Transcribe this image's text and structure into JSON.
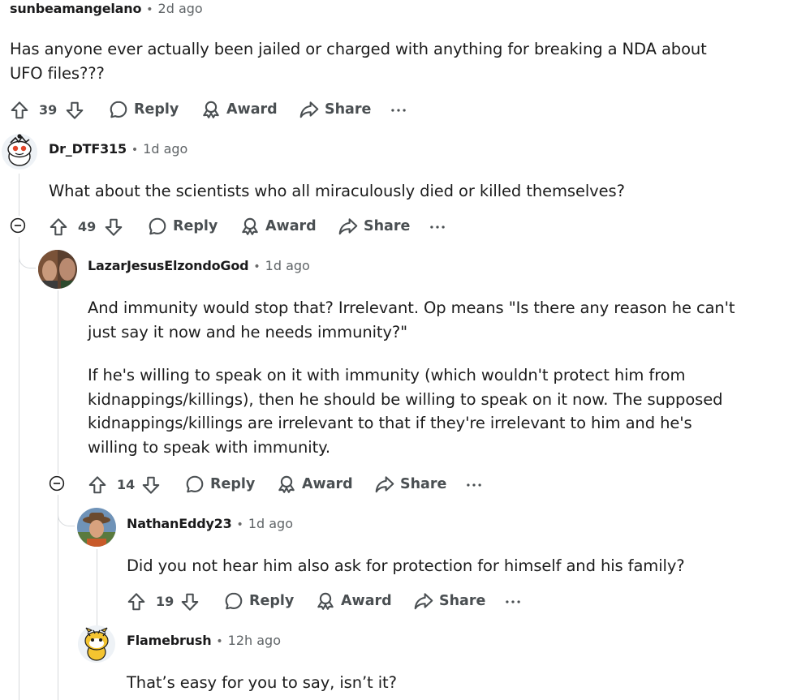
{
  "comments": [
    {
      "username": "sunbeamangelano",
      "separator": "•",
      "time": "2d ago",
      "text_lines": [
        "Has anyone ever actually been jailed or charged with anything for breaking a NDA about",
        "UFO files???"
      ],
      "votes": "39",
      "reply_label": "Reply",
      "award_label": "Award",
      "share_label": "Share",
      "more_label": "···"
    },
    {
      "username": "Dr_DTF315",
      "separator": "•",
      "time": "1d ago",
      "text_lines": [
        "What about the scientists who all miraculously died or killed themselves?"
      ],
      "votes": "49",
      "reply_label": "Reply",
      "award_label": "Award",
      "share_label": "Share",
      "more_label": "···"
    },
    {
      "username": "LazarJesusElzondoGod",
      "separator": "•",
      "time": "1d ago",
      "paragraph1_lines": [
        "And immunity would stop that? Irrelevant. Op means \"Is there any reason he can't",
        "just say it now and he needs immunity?\""
      ],
      "paragraph2_lines": [
        "If he's willing to speak on it with immunity (which wouldn't protect him from",
        "kidnappings/killings), then he should be willing to speak on it now. The supposed",
        "kidnappings/killings are irrelevant to that if they're irrelevant to him and he's",
        "willing to speak with immunity."
      ],
      "votes": "14",
      "reply_label": "Reply",
      "award_label": "Award",
      "share_label": "Share",
      "more_label": "···"
    },
    {
      "username": "NathanEddy23",
      "separator": "•",
      "time": "1d ago",
      "text_lines": [
        "Did you not hear him also ask for protection for himself and his family?"
      ],
      "votes": "19",
      "reply_label": "Reply",
      "award_label": "Award",
      "share_label": "Share",
      "more_label": "···"
    },
    {
      "username": "Flamebrush",
      "separator": "•",
      "time": "12h ago",
      "text_lines": [
        "That’s easy for you to say, isn’t it?"
      ]
    }
  ],
  "icons": {
    "upvote": "upvote-arrow-icon",
    "downvote": "downvote-arrow-icon",
    "reply": "speech-bubble-icon",
    "award": "award-ribbon-icon",
    "share": "share-arrow-icon",
    "more": "more-options-icon",
    "collapse": "collapse-minus-icon"
  },
  "colors": {
    "text": "#1c1c1c",
    "meta": "#5f6467",
    "thread_line": "#d6d9dc",
    "action": "#4a4f52"
  }
}
